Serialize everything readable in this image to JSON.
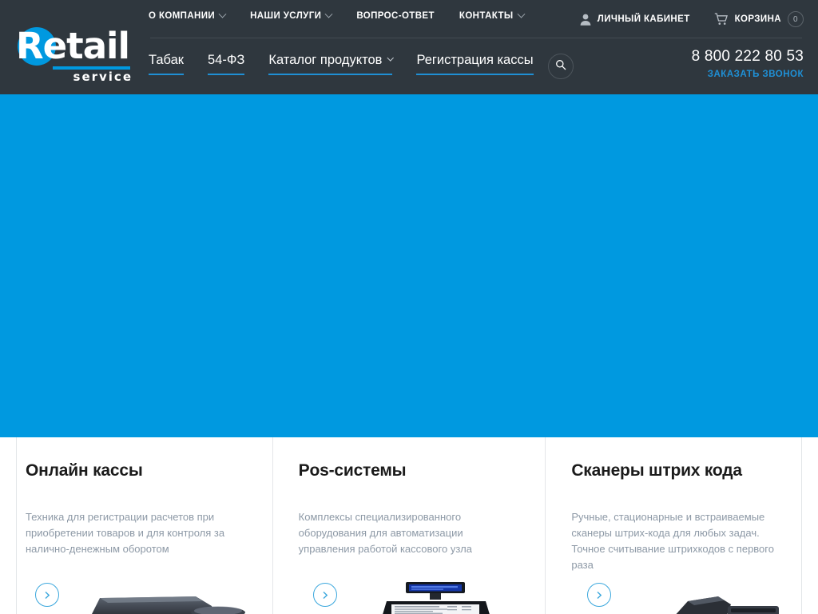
{
  "brand": {
    "logo_main": "Retail",
    "logo_r": "R",
    "logo_rest": "etail",
    "logo_sub": "service"
  },
  "header": {
    "top_nav": [
      {
        "label": "О КОМПАНИИ",
        "has_caret": true
      },
      {
        "label": "НАШИ УСЛУГИ",
        "has_caret": true
      },
      {
        "label": "ВОПРОС-ОТВЕТ",
        "has_caret": false
      },
      {
        "label": "КОНТАКТЫ",
        "has_caret": true
      }
    ],
    "account": {
      "cabinet_label": "ЛИЧНЫЙ КАБИНЕТ",
      "cart_label": "КОРЗИНА",
      "cart_count": "0"
    },
    "main_nav": [
      {
        "label": "Табак",
        "has_caret": false
      },
      {
        "label": "54-ФЗ",
        "has_caret": false
      },
      {
        "label": "Каталог продуктов",
        "has_caret": true
      },
      {
        "label": "Регистрация кассы",
        "has_caret": false
      }
    ],
    "search_icon": "search-icon",
    "phone": "8 800 222 80 53",
    "call_back": "ЗАКАЗАТЬ ЗВОНОК"
  },
  "hero": {
    "background_color": "#0099e0"
  },
  "cards": [
    {
      "title": "Онлайн кассы",
      "text": "Техника для регистрации расчетов при приобретении товаров и для контроля за налично-денежным оборотом",
      "arrow_icon": "chevron-right-icon"
    },
    {
      "title": "Pos-системы",
      "text": "Комплексы специализированного оборудования для автоматизации управления работой кассового узла",
      "arrow_icon": "chevron-right-icon"
    },
    {
      "title": "Сканеры штрих кода",
      "text": "Ручные, стационарные и встраиваемые сканеры штрих-кода для любых задач. Точное считывание штрихкодов с первого раза",
      "arrow_icon": "chevron-right-icon"
    }
  ],
  "colors": {
    "header_bg": "#2f373e",
    "accent_blue": "#0099e0",
    "link_blue": "#1f90d6",
    "card_text": "#8d99a6"
  }
}
